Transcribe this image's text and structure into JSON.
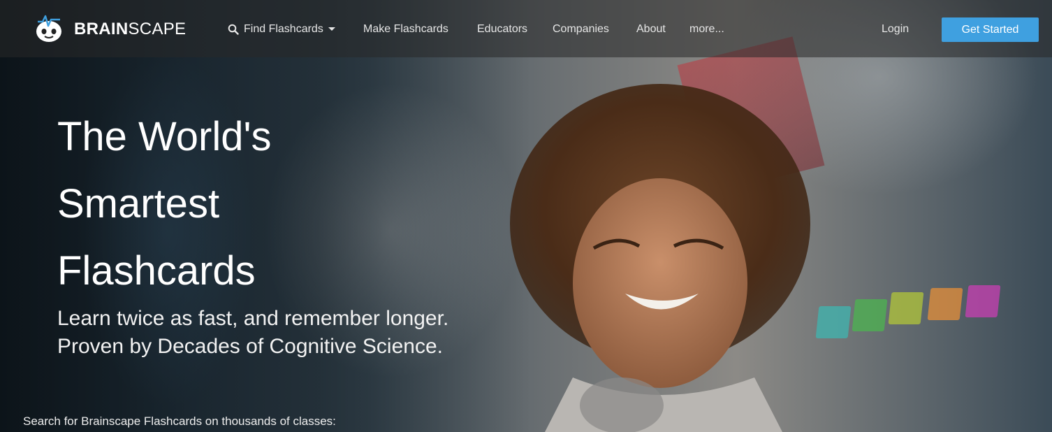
{
  "brand": {
    "name_bold": "BRAIN",
    "name_light": "SCAPE"
  },
  "nav": {
    "items": [
      {
        "label": "Find Flashcards",
        "icon": "search-icon",
        "dropdown": true
      },
      {
        "label": "Make Flashcards"
      },
      {
        "label": "Educators"
      },
      {
        "label": "Companies"
      },
      {
        "label": "About"
      },
      {
        "label": "more..."
      }
    ],
    "login_label": "Login",
    "cta_label": "Get Started"
  },
  "hero": {
    "headline_lines": [
      "The World's",
      "Smartest",
      "Flashcards"
    ],
    "subtext_lines": [
      "Learn twice as fast, and remember longer.",
      "Proven by Decades of Cognitive Science."
    ],
    "search_label": "Search for Brainscape Flashcards on thousands of classes:"
  },
  "colors": {
    "accent": "#3fa0e0",
    "nav_bg": "#2a2a2a",
    "text": "#ffffff"
  }
}
